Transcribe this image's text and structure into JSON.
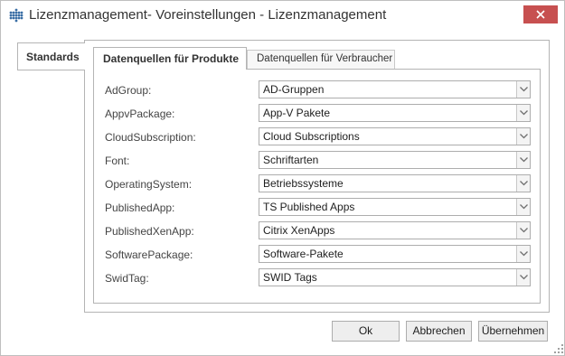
{
  "window": {
    "title": "Lizenzmanagement- Voreinstellungen - Lizenzmanagement",
    "close_icon": "close-icon",
    "app_icon": "grid-dots-icon"
  },
  "outer_tabs": [
    {
      "label": "Standards",
      "selected": true
    }
  ],
  "inner_tabs": [
    {
      "label": "Datenquellen für Produkte",
      "selected": true
    },
    {
      "label": "Datenquellen für Verbraucher",
      "selected": false
    }
  ],
  "rows": [
    {
      "label": "AdGroup:",
      "value": "AD-Gruppen"
    },
    {
      "label": "AppvPackage:",
      "value": "App-V Pakete"
    },
    {
      "label": "CloudSubscription:",
      "value": "Cloud Subscriptions"
    },
    {
      "label": "Font:",
      "value": "Schriftarten"
    },
    {
      "label": "OperatingSystem:",
      "value": "Betriebssysteme"
    },
    {
      "label": "PublishedApp:",
      "value": "TS Published Apps"
    },
    {
      "label": "PublishedXenApp:",
      "value": "Citrix XenApps"
    },
    {
      "label": "SoftwarePackage:",
      "value": "Software-Pakete"
    },
    {
      "label": "SwidTag:",
      "value": "SWID Tags"
    }
  ],
  "buttons": {
    "ok": "Ok",
    "cancel": "Abbrechen",
    "apply": "Übernehmen"
  },
  "colors": {
    "close_button": "#c75050",
    "app_icon": "#3a6ea5"
  }
}
